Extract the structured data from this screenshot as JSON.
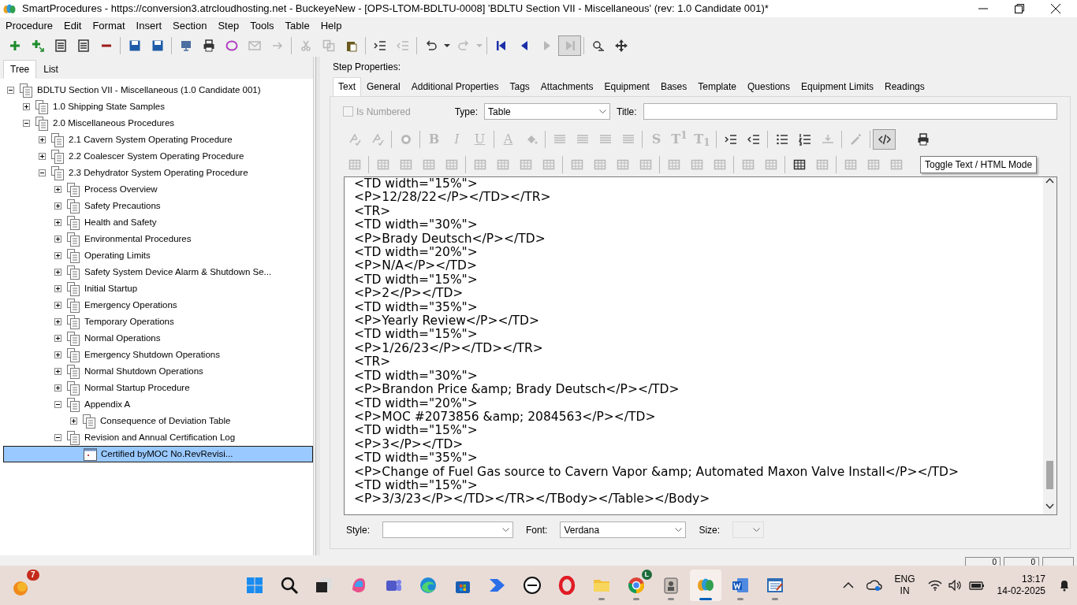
{
  "window": {
    "title": "SmartProcedures - https://conversion3.atrcloudhosting.net - BuckeyeNew - [OPS-LTOM-BDLTU-0008] 'BDLTU Section VII - Miscellaneous' (rev: 1.0 Candidate 001)*"
  },
  "menu": [
    "Procedure",
    "Edit",
    "Format",
    "Insert",
    "Section",
    "Step",
    "Tools",
    "Table",
    "Help"
  ],
  "toolbar": [
    {
      "kind": "plus",
      "disabled": false
    },
    {
      "kind": "plusarrow",
      "disabled": false
    },
    {
      "kind": "doclines",
      "disabled": false
    },
    {
      "kind": "doclines",
      "disabled": false
    },
    {
      "kind": "minus",
      "disabled": false
    },
    {
      "kind": "sep"
    },
    {
      "kind": "disk",
      "disabled": false
    },
    {
      "kind": "disk",
      "disabled": false
    },
    {
      "kind": "sep"
    },
    {
      "kind": "monitor",
      "disabled": false
    },
    {
      "kind": "printer",
      "disabled": false
    },
    {
      "kind": "ring",
      "disabled": false
    },
    {
      "kind": "envelope",
      "disabled": true
    },
    {
      "kind": "arrowright",
      "disabled": true
    },
    {
      "kind": "sep"
    },
    {
      "kind": "scissors",
      "disabled": true
    },
    {
      "kind": "copy",
      "disabled": true
    },
    {
      "kind": "clipboard",
      "disabled": false
    },
    {
      "kind": "sep"
    },
    {
      "kind": "indent",
      "disabled": false
    },
    {
      "kind": "outdent",
      "disabled": true
    },
    {
      "kind": "sep"
    },
    {
      "kind": "undo",
      "disabled": false
    },
    {
      "kind": "caret",
      "disabled": false
    },
    {
      "kind": "redo",
      "disabled": true
    },
    {
      "kind": "caret",
      "disabled": true
    },
    {
      "kind": "sep"
    },
    {
      "kind": "first",
      "disabled": false
    },
    {
      "kind": "prev",
      "disabled": false
    },
    {
      "kind": "next",
      "disabled": true
    },
    {
      "kind": "last",
      "disabled": true,
      "pressed": true
    },
    {
      "kind": "sep"
    },
    {
      "kind": "find",
      "disabled": false
    },
    {
      "kind": "move",
      "disabled": false
    }
  ],
  "tree_tabs": [
    {
      "label": "Tree",
      "selected": true
    },
    {
      "label": "List",
      "selected": false
    }
  ],
  "tree": {
    "label": "BDLTU Section VII - Miscellaneous (1.0 Candidate 001)",
    "expanded": true,
    "selected": false,
    "children": [
      {
        "label": "1.0 Shipping State Samples",
        "expanded": false,
        "selected": false
      },
      {
        "label": "2.0 Miscellaneous Procedures",
        "expanded": true,
        "selected": false,
        "children": [
          {
            "label": "2.1 Cavern System Operating Procedure",
            "expanded": false,
            "selected": false
          },
          {
            "label": "2.2 Coalescer System Operating Procedure",
            "expanded": false,
            "selected": false
          },
          {
            "label": "2.3 Dehydrator System Operating Procedure",
            "expanded": true,
            "selected": false,
            "children": [
              {
                "label": "Process Overview",
                "expanded": false,
                "selected": false
              },
              {
                "label": "Safety Precautions",
                "expanded": false,
                "selected": false
              },
              {
                "label": "Health and Safety",
                "expanded": false,
                "selected": false
              },
              {
                "label": "Environmental Procedures",
                "expanded": false,
                "selected": false
              },
              {
                "label": "Operating Limits",
                "expanded": false,
                "selected": false
              },
              {
                "label": "Safety System Device Alarm & Shutdown Se...",
                "expanded": false,
                "selected": false
              },
              {
                "label": "Initial Startup",
                "expanded": false,
                "selected": false
              },
              {
                "label": "Emergency Operations",
                "expanded": false,
                "selected": false
              },
              {
                "label": "Temporary Operations",
                "expanded": false,
                "selected": false
              },
              {
                "label": "Normal Operations",
                "expanded": false,
                "selected": false
              },
              {
                "label": "Emergency Shutdown Operations",
                "expanded": false,
                "selected": false
              },
              {
                "label": "Normal Shutdown Operations",
                "expanded": false,
                "selected": false
              },
              {
                "label": "Normal Startup Procedure",
                "expanded": false,
                "selected": false
              },
              {
                "label": "Appendix A",
                "expanded": true,
                "selected": false,
                "children": [
                  {
                    "label": "Consequence of Deviation Table",
                    "expanded": false,
                    "selected": false
                  }
                ]
              },
              {
                "label": "Revision and Annual Certification Log",
                "expanded": true,
                "selected": false,
                "children": [
                  {
                    "label": "Certified byMOC No.RevRevisi...",
                    "kind": "table",
                    "selected": true
                  }
                ]
              }
            ]
          }
        ]
      }
    ]
  },
  "step_properties": {
    "label": "Step Properties:",
    "tabs": [
      {
        "label": "Text",
        "selected": true
      },
      {
        "label": "General",
        "selected": false
      },
      {
        "label": "Additional Properties",
        "selected": false
      },
      {
        "label": "Tags",
        "selected": false
      },
      {
        "label": "Attachments",
        "selected": false
      },
      {
        "label": "Equipment",
        "selected": false
      },
      {
        "label": "Bases",
        "selected": false
      },
      {
        "label": "Template",
        "selected": false
      },
      {
        "label": "Questions",
        "selected": false
      },
      {
        "label": "Equipment Limits",
        "selected": false
      },
      {
        "label": "Readings",
        "selected": false
      }
    ],
    "is_numbered": {
      "label": "Is Numbered",
      "checked": false,
      "disabled": true
    },
    "type": {
      "label": "Type:",
      "value": "Table"
    },
    "title": {
      "label": "Title:"
    },
    "editor_toolbar_1": [
      {
        "kind": "spell",
        "disabled": true
      },
      {
        "kind": "spell",
        "disabled": true
      },
      {
        "kind": "sep"
      },
      {
        "kind": "globe",
        "disabled": true
      },
      {
        "kind": "sep"
      },
      {
        "kind": "bold",
        "text": "B",
        "disabled": true
      },
      {
        "kind": "italic",
        "text": "I",
        "disabled": true
      },
      {
        "kind": "underline",
        "text": "U",
        "disabled": true
      },
      {
        "kind": "sep"
      },
      {
        "kind": "underline",
        "text": "A",
        "disabled": true
      },
      {
        "kind": "bucket",
        "disabled": true
      },
      {
        "kind": "sep"
      },
      {
        "kind": "align",
        "disabled": true
      },
      {
        "kind": "align",
        "disabled": true
      },
      {
        "kind": "align",
        "disabled": true
      },
      {
        "kind": "align",
        "disabled": true
      },
      {
        "kind": "sep"
      },
      {
        "kind": "bold",
        "text": "S",
        "disabled": true
      },
      {
        "kind": "bold",
        "text": "T$^{1}$",
        "disabled": true
      },
      {
        "kind": "bold",
        "text": "T$_{1}$",
        "disabled": true
      },
      {
        "kind": "sep"
      },
      {
        "kind": "indent",
        "disabled": false
      },
      {
        "kind": "outdent",
        "disabled": false
      },
      {
        "kind": "sep"
      },
      {
        "kind": "bullets",
        "disabled": false
      },
      {
        "kind": "numbers",
        "disabled": false
      },
      {
        "kind": "hr",
        "disabled": true
      },
      {
        "kind": "sep"
      },
      {
        "kind": "wand",
        "disabled": true
      },
      {
        "kind": "sep"
      },
      {
        "kind": "code",
        "disabled": false,
        "pressed": true
      },
      {
        "kind": "gap"
      },
      {
        "kind": "print",
        "disabled": false
      }
    ],
    "editor_toolbar_2": [
      {
        "kind": "grid",
        "disabled": true
      },
      {
        "kind": "sep"
      },
      {
        "kind": "grid",
        "disabled": true
      },
      {
        "kind": "grid",
        "disabled": true
      },
      {
        "kind": "grid",
        "disabled": true
      },
      {
        "kind": "grid",
        "disabled": true
      },
      {
        "kind": "sep"
      },
      {
        "kind": "grid",
        "disabled": true
      },
      {
        "kind": "grid",
        "disabled": true
      },
      {
        "kind": "grid",
        "disabled": true
      },
      {
        "kind": "grid",
        "disabled": true
      },
      {
        "kind": "sep"
      },
      {
        "kind": "grid",
        "disabled": true
      },
      {
        "kind": "grid",
        "disabled": true
      },
      {
        "kind": "grid",
        "disabled": true
      },
      {
        "kind": "grid",
        "disabled": true
      },
      {
        "kind": "sep"
      },
      {
        "kind": "grid",
        "disabled": true
      },
      {
        "kind": "grid",
        "disabled": true
      },
      {
        "kind": "grid",
        "disabled": true
      },
      {
        "kind": "sep"
      },
      {
        "kind": "grid",
        "disabled": true
      },
      {
        "kind": "grid",
        "disabled": true
      },
      {
        "kind": "sep"
      },
      {
        "kind": "grid",
        "disabled": false
      },
      {
        "kind": "grid",
        "disabled": true
      },
      {
        "kind": "sep"
      },
      {
        "kind": "grid",
        "disabled": true
      },
      {
        "kind": "grid",
        "disabled": true
      },
      {
        "kind": "grid",
        "disabled": true
      }
    ],
    "tooltip": "Toggle Text / HTML Mode",
    "code_lines": [
      "<TD width=\"15%\">",
      "<P>12/28/22</P></TD></TR>",
      "<TR>",
      "<TD width=\"30%\">",
      "<P>Brady Deutsch</P></TD>",
      "<TD width=\"20%\">",
      "<P>N/A</P></TD>",
      "<TD width=\"15%\">",
      "<P>2</P></TD>",
      "<TD width=\"35%\">",
      "<P>Yearly Review</P></TD>",
      "<TD width=\"15%\">",
      "<P>1/26/23</P></TD></TR>",
      "<TR>",
      "<TD width=\"30%\">",
      "<P>Brandon Price &amp; Brady Deutsch</P></TD>",
      "<TD width=\"20%\">",
      "<P>MOC #2073856 &amp; 2084563</P></TD>",
      "<TD width=\"15%\">",
      "<P>3</P></TD>",
      "<TD width=\"35%\">",
      "<P>Change of Fuel Gas source to Cavern Vapor &amp; Automated Maxon Valve Install</P></TD>",
      "<TD width=\"15%\">",
      "<P>3/3/23</P></TD></TR></TBody></Table></Body>"
    ],
    "style": {
      "label": "Style:"
    },
    "font": {
      "label": "Font:",
      "value": "Verdana"
    },
    "size": {
      "label": "Size:"
    }
  },
  "status_panels": [
    "0",
    "0"
  ],
  "taskbar": {
    "weather_badge": "7",
    "apps": [
      {
        "kind": "start",
        "running": false,
        "active": false
      },
      {
        "kind": "search",
        "running": false,
        "active": false
      },
      {
        "kind": "taskview",
        "running": false,
        "active": false
      },
      {
        "kind": "copilot",
        "running": false,
        "active": false
      },
      {
        "kind": "teams",
        "running": false,
        "active": false
      },
      {
        "kind": "edge",
        "running": false,
        "active": false
      },
      {
        "kind": "store",
        "running": false,
        "active": false
      },
      {
        "kind": "automate",
        "running": false,
        "active": false
      },
      {
        "kind": "dell",
        "running": false,
        "active": false
      },
      {
        "kind": "opera",
        "running": false,
        "active": false
      },
      {
        "kind": "folder",
        "running": true,
        "active": false
      },
      {
        "kind": "chrome",
        "running": true,
        "active": false,
        "badge": "L"
      },
      {
        "kind": "badgeapp",
        "running": true,
        "active": false
      },
      {
        "kind": "butterfly",
        "running": true,
        "active": true
      },
      {
        "kind": "word",
        "running": true,
        "active": false
      },
      {
        "kind": "editor",
        "running": true,
        "active": false
      }
    ],
    "language": "ENG",
    "region": "IN",
    "time": "13:17",
    "date": "14-02-2025"
  }
}
